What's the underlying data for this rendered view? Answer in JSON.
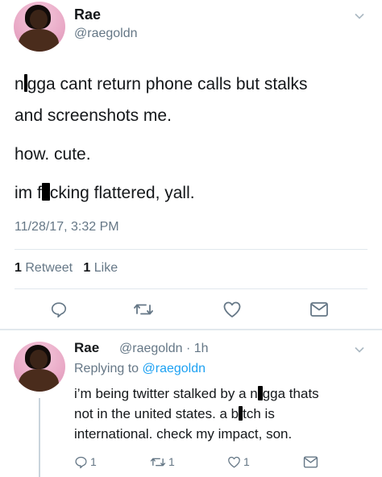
{
  "main_tweet": {
    "display_name": "Rae",
    "handle": "@raegoldn",
    "lines": [
      {
        "pre": "n",
        "post": "gga cant return phone calls but stalks"
      },
      {
        "text": "and screenshots me."
      },
      {
        "text": "how. cute."
      },
      {
        "pre": "im f",
        "post": "cking flattered, yall."
      }
    ],
    "timestamp": "11/28/17, 3:32 PM",
    "retweet_count": "1",
    "retweet_label": "Retweet",
    "like_count": "1",
    "like_label": "Like",
    "actions": [
      "reply-icon",
      "retweet-icon",
      "like-icon",
      "message-icon"
    ]
  },
  "reply_tweet": {
    "display_name": "Rae",
    "handle": "@raegoldn",
    "time_ago": "1h",
    "replying_prefix": "Replying to",
    "replying_to": "@raegoldn",
    "line1_pre": "i’m being twitter stalked by a n",
    "line1_post": "gga thats",
    "line2_pre": "not in the united states.  a b",
    "line2_post": "tch is",
    "line3": "international.  check my impact, son.",
    "reply_count": "1",
    "retweet_count": "1",
    "like_count": "1"
  },
  "colors": {
    "text": "#14171a",
    "secondary": "#657786",
    "link": "#1da1f2",
    "divider": "#e1e8ed"
  }
}
